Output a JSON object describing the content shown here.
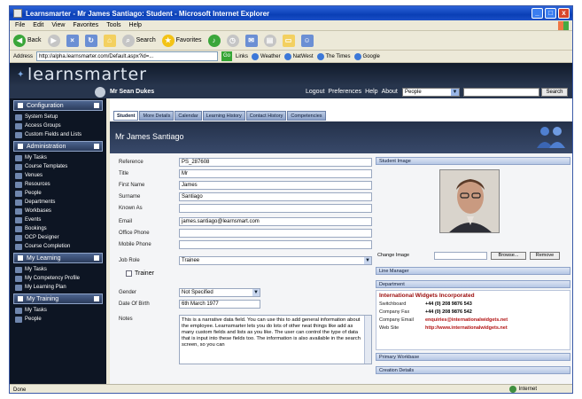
{
  "window": {
    "title": "Learnsmarter - Mr James Santiago: Student - Microsoft Internet Explorer",
    "controls": [
      "_",
      "□",
      "x"
    ]
  },
  "menu": [
    "File",
    "Edit",
    "View",
    "Favorites",
    "Tools",
    "Help"
  ],
  "toolbar": {
    "back": "Back",
    "search": "Search",
    "favorites": "Favorites"
  },
  "address": {
    "label": "Address",
    "url": "http://alpha.learnsmarter.com/Default.aspx?id=...",
    "go": "Go",
    "links_label": "Links",
    "links": [
      "Weather",
      "NatWest",
      "The Times",
      "Google"
    ]
  },
  "app": {
    "logo": "learnsmarter",
    "user": "Mr Sean Dukes",
    "top_links": [
      "Logout",
      "Preferences",
      "Help",
      "About"
    ],
    "people_select": "People",
    "search_button": "Search"
  },
  "sidebar": {
    "sections": [
      {
        "title": "Configuration",
        "items": [
          "System Setup",
          "Access Groups",
          "Custom Fields and Lists"
        ]
      },
      {
        "title": "Administration",
        "items": [
          "My Tasks",
          "Course Templates",
          "Venues",
          "Resources",
          "People",
          "Departments",
          "Workbases",
          "Events",
          "Bookings",
          "OCP Designer",
          "Course Completion"
        ]
      },
      {
        "title": "My Learning",
        "items": [
          "My Tasks",
          "My Competency Profile",
          "My Learning Plan"
        ]
      },
      {
        "title": "My Training",
        "items": [
          "My Tasks",
          "People"
        ]
      }
    ]
  },
  "tabs": [
    "Student",
    "More Details",
    "Calendar",
    "Learning History",
    "Contact History",
    "Competencies"
  ],
  "person_title": "Mr James Santiago",
  "form": {
    "reference": {
      "label": "Reference",
      "value": "PS_287608"
    },
    "title": {
      "label": "Title",
      "value": "Mr"
    },
    "first_name": {
      "label": "First Name",
      "value": "James"
    },
    "surname": {
      "label": "Surname",
      "value": "Santiago"
    },
    "known_as": {
      "label": "Known As",
      "value": ""
    },
    "email": {
      "label": "Email",
      "value": "james.santiago@learnsmart.com"
    },
    "office_phone": {
      "label": "Office Phone",
      "value": ""
    },
    "mobile_phone": {
      "label": "Mobile Phone",
      "value": ""
    },
    "job_role": {
      "label": "Job Role",
      "value": "Trainee"
    },
    "trainer": {
      "label": "Trainer"
    },
    "gender": {
      "label": "Gender",
      "value": "Not Specified"
    },
    "dob": {
      "label": "Date Of Birth",
      "value": "6th March 1977"
    },
    "notes": {
      "label": "Notes",
      "value": "This is a narrative data field. You can use this to add general information about the employee. Learnsmarter lets you do lots of other neat things like add as many custom fields and lists as you like. The user can control the type of data that is input into these fields too. The information is also available in the search screen, so you can"
    }
  },
  "panels": {
    "student_image": "Student Image",
    "change_image": "Change Image",
    "browse": "Browse...",
    "remove": "Remove",
    "line_manager": "Line Manager",
    "department": "Department",
    "primary_workbase": "Primary Workbase",
    "creation_details": "Creation Details"
  },
  "department": {
    "name": "International Widgets Incorporated",
    "rows": [
      {
        "k": "Switchboard",
        "v": "+44 (0) 208 9876 543"
      },
      {
        "k": "Company Fax",
        "v": "+44 (0) 208 9876 542"
      },
      {
        "k": "Company Email",
        "v": "enquiries@internationalwidgets.net"
      },
      {
        "k": "Web Site",
        "v": "http://www.internationalwidgets.net"
      }
    ]
  },
  "status": {
    "left": "Done",
    "zone": "Internet"
  },
  "colors": {
    "header_dark": "#101a2a",
    "sidebar_bg": "#0d1523",
    "dept_red": "#9a0a0a"
  }
}
